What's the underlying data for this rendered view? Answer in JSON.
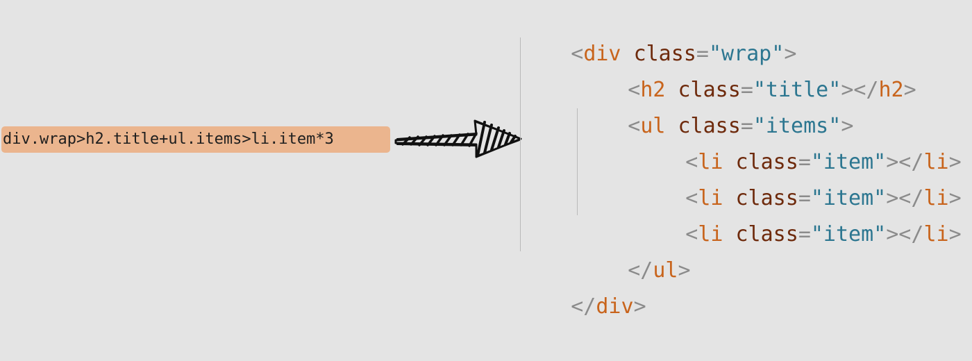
{
  "abbreviation": "div.wrap>h2.title+ul.items>li.item*3",
  "code_lines": [
    {
      "open": "<",
      "tag": "div",
      "attr": "class",
      "eq": "=",
      "value": "\"wrap\"",
      "close": ">"
    },
    {
      "open": "<",
      "tag": "h2",
      "attr": "class",
      "eq": "=",
      "value": "\"title\"",
      "close": "></",
      "tag2": "h2",
      "end": ">"
    },
    {
      "open": "<",
      "tag": "ul",
      "attr": "class",
      "eq": "=",
      "value": "\"items\"",
      "close": ">"
    },
    {
      "open": "<",
      "tag": "li",
      "attr": "class",
      "eq": "=",
      "value": "\"item\"",
      "close": "></",
      "tag2": "li",
      "end": ">"
    },
    {
      "open": "<",
      "tag": "li",
      "attr": "class",
      "eq": "=",
      "value": "\"item\"",
      "close": "></",
      "tag2": "li",
      "end": ">"
    },
    {
      "open": "<",
      "tag": "li",
      "attr": "class",
      "eq": "=",
      "value": "\"item\"",
      "close": "></",
      "tag2": "li",
      "end": ">"
    },
    {
      "open": "</",
      "tag": "ul",
      "close": ">"
    },
    {
      "open": "</",
      "tag": "div",
      "close": ">"
    }
  ],
  "colors": {
    "background": "#e4e4e4",
    "abbreviation_highlight": "#ebb58e",
    "tag": "#c8641c",
    "attribute": "#6e2a0c",
    "string": "#2c7690",
    "punctuation": "#8b8b8b"
  }
}
